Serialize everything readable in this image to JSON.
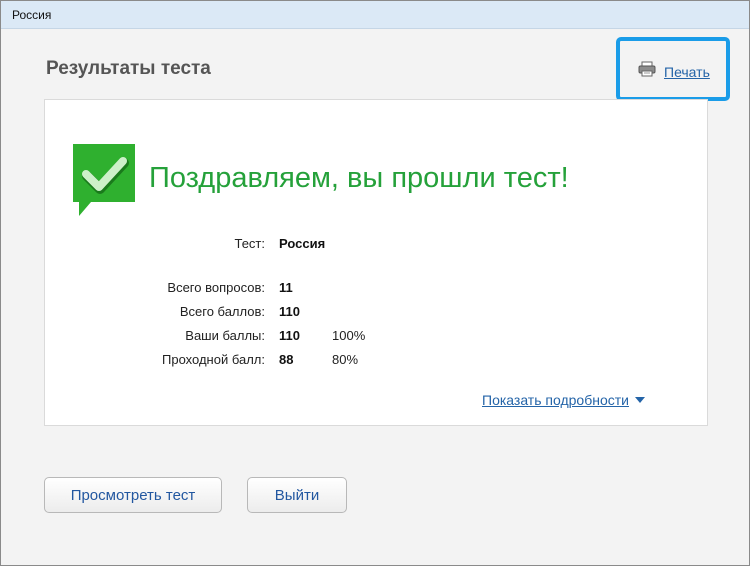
{
  "window": {
    "title": "Россия"
  },
  "header": {
    "title": "Результаты теста",
    "print_label": "Печать"
  },
  "result": {
    "message": "Поздравляем, вы прошли тест!",
    "test_label": "Тест:",
    "test_name": "Россия",
    "stats": [
      {
        "label": "Всего вопросов:",
        "value": "11",
        "percent": ""
      },
      {
        "label": "Всего баллов:",
        "value": "110",
        "percent": ""
      },
      {
        "label": "Ваши баллы:",
        "value": "110",
        "percent": "100%"
      },
      {
        "label": "Проходной балл:",
        "value": "88",
        "percent": "80%"
      }
    ],
    "details_label": "Показать подробности"
  },
  "buttons": {
    "review_label": "Просмотреть тест",
    "exit_label": "Выйти"
  },
  "icons": {
    "print": "printer-icon",
    "badge": "checkmark-speech-bubble-icon",
    "details": "caret-down-icon"
  },
  "colors": {
    "accent_green": "#25a13a",
    "badge_green": "#2fb02f",
    "link_blue": "#2464a8",
    "highlight_blue": "#1a9ce8"
  }
}
